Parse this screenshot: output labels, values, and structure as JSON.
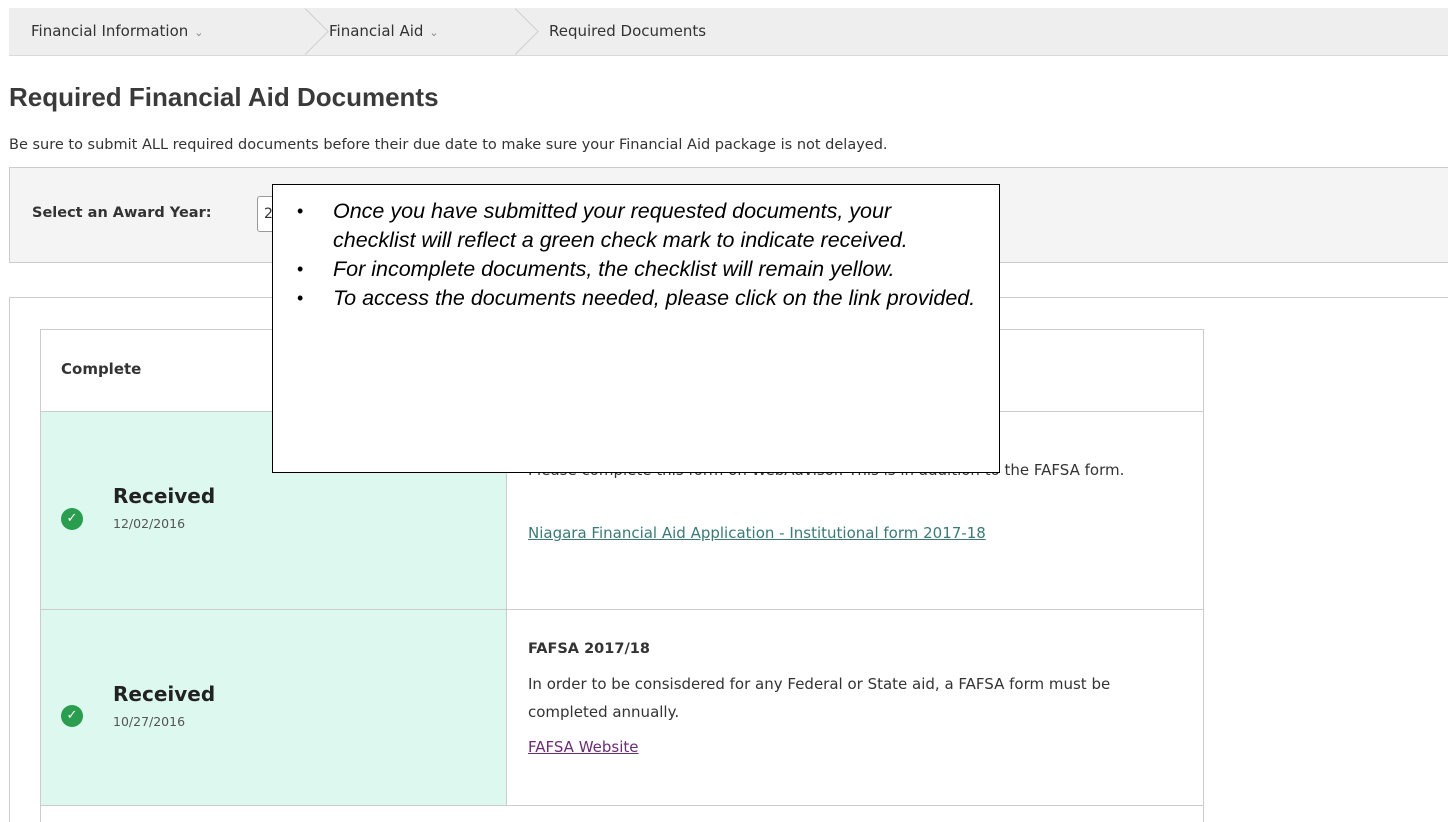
{
  "breadcrumb": {
    "items": [
      {
        "label": "Financial Information",
        "has_dropdown": true
      },
      {
        "label": "Financial Aid",
        "has_dropdown": true
      },
      {
        "label": "Required Documents",
        "has_dropdown": false
      }
    ]
  },
  "page": {
    "title": "Required Financial Aid Documents",
    "description": "Be sure to submit ALL required documents before their due date to make sure your Financial Aid package is not delayed."
  },
  "filter": {
    "label": "Select an Award Year:",
    "selected_value": "2"
  },
  "checklist": {
    "header": "Complete",
    "rows": [
      {
        "status": "Received",
        "date": "12/02/2016",
        "title": "",
        "description": "Please complete this form on WebAdvisor. This is in addition to the FAFSA form.",
        "link": "Niagara Financial Aid Application - Institutional form 2017-18"
      },
      {
        "status": "Received",
        "date": "10/27/2016",
        "title": "FAFSA 2017/18",
        "description": "In order to be consisdered for any Federal or State aid, a FAFSA form must be completed annually.",
        "link": "FAFSA Website"
      }
    ]
  },
  "callout": {
    "bullets": [
      "Once you have submitted your requested documents, your checklist will reflect a green check mark to indicate received.",
      "For incomplete documents, the checklist will remain yellow.",
      "To access the documents needed, please click on the link provided."
    ]
  },
  "colors": {
    "received_bg": "#dcf8ef",
    "check_icon": "#2a9d4e",
    "link_teal": "#3b7a77",
    "link_visited": "#6a2d73"
  },
  "icons": {
    "crumb_dropdown": "chevron-down-icon",
    "status": "check-circle-icon",
    "callout_bullet": "bullet-dot"
  }
}
